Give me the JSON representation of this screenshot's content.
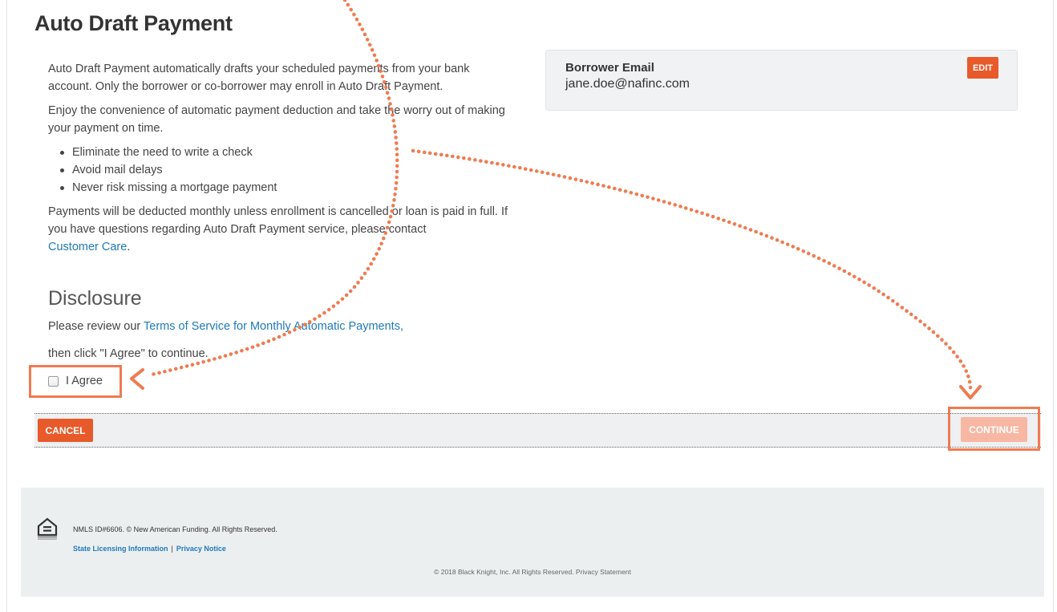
{
  "page": {
    "title": "Auto Draft Payment"
  },
  "intro": {
    "paragraph1": "Auto Draft Payment automatically drafts your scheduled payments from your bank account. Only the borrower or co-borrower may enroll in Auto Draft Payment.",
    "paragraph2": "Enjoy the convenience of automatic payment deduction and take the worry out of making your payment on time.",
    "bullets": [
      "Eliminate the need to write a check",
      "Avoid mail delays",
      "Never risk missing a mortgage payment"
    ],
    "paragraph3": "Payments will be deducted monthly unless enrollment is cancelled or loan is paid in full. If you have questions regarding Auto Draft Payment service, please contact",
    "customer_care_link": "Customer Care",
    "paragraph3_end": "."
  },
  "disclosure": {
    "title": "Disclosure",
    "review_prefix": "Please review our ",
    "terms_link": "Terms of Service for Monthly Automatic Payments,",
    "instruction": "then click \"I Agree\" to continue.",
    "agree_label": "I Agree",
    "agree_checked": false
  },
  "email_card": {
    "label": "Borrower Email",
    "value": "jane.doe@nafinc.com",
    "edit_label": "EDIT"
  },
  "actions": {
    "cancel_label": "CANCEL",
    "continue_label": "CONTINUE",
    "continue_enabled": false
  },
  "footer": {
    "nmls": "NMLS ID#6606. © New American Funding. All Rights Reserved.",
    "state_licensing_link": "State Licensing Information",
    "separator": "|",
    "privacy_link": "Privacy Notice",
    "copyright": "© 2018 Black Knight, Inc. All Rights Reserved. Privacy Statement"
  },
  "colors": {
    "accent_orange": "#e85a2a",
    "annotation_orange": "#ef7b52",
    "disabled_orange": "#f7b7a2",
    "link_blue": "#1f7ab8"
  },
  "icons": {
    "footer_logo": "equal-housing-icon"
  }
}
